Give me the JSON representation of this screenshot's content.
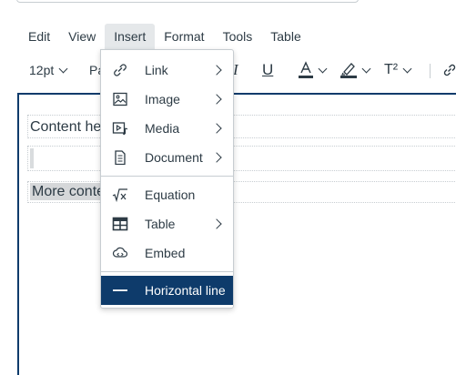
{
  "menubar": {
    "items": [
      {
        "label": "Edit"
      },
      {
        "label": "View"
      },
      {
        "label": "Insert"
      },
      {
        "label": "Format"
      },
      {
        "label": "Tools"
      },
      {
        "label": "Table"
      }
    ]
  },
  "toolbar": {
    "font_size": "12pt",
    "paragraph_partial": "Pa",
    "superscript_label": "T²"
  },
  "editor": {
    "line1": "Content he",
    "line3": "More conte"
  },
  "insert_menu": {
    "items": [
      {
        "label": "Link",
        "icon": "link-icon"
      },
      {
        "label": "Image",
        "icon": "image-icon"
      },
      {
        "label": "Media",
        "icon": "media-icon"
      },
      {
        "label": "Document",
        "icon": "document-icon"
      },
      {
        "label": "Equation",
        "icon": "equation-icon"
      },
      {
        "label": "Table",
        "icon": "table-icon"
      },
      {
        "label": "Embed",
        "icon": "embed-icon"
      },
      {
        "label": "Horizontal line",
        "icon": "horizontal-line-icon"
      }
    ],
    "highlight_color": "#0e3b6b"
  }
}
